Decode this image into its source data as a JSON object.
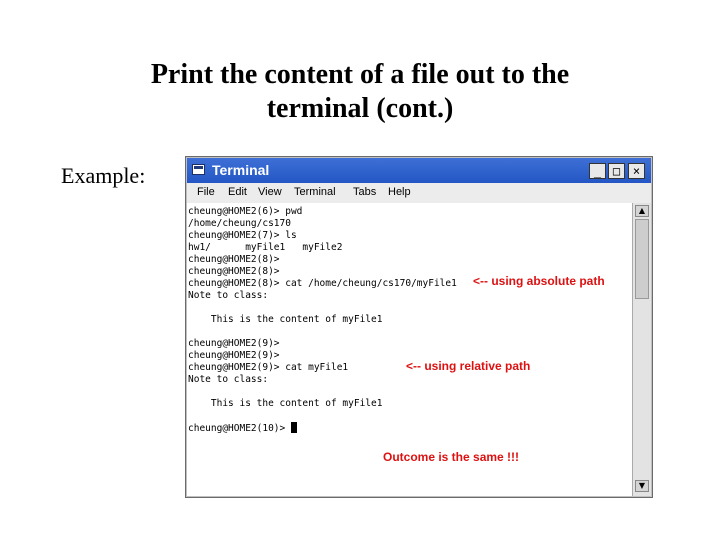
{
  "slide": {
    "title_line1": "Print the content of a file out to the",
    "title_line2": "terminal (cont.)",
    "example_label": "Example:"
  },
  "window": {
    "title": "Terminal",
    "controls": [
      "_",
      "□",
      "×"
    ]
  },
  "menu": [
    "File",
    "Edit",
    "View",
    "Terminal",
    "Tabs",
    "Help"
  ],
  "terminal_lines": [
    "cheung@HOME2(6)> pwd",
    "/home/cheung/cs170",
    "cheung@HOME2(7)> ls",
    "hw1/      myFile1   myFile2",
    "cheung@HOME2(8)>",
    "cheung@HOME2(8)>",
    "cheung@HOME2(8)> cat /home/cheung/cs170/myFile1",
    "Note to class:",
    "",
    "    This is the content of myFile1",
    "",
    "cheung@HOME2(9)>",
    "cheung@HOME2(9)>",
    "cheung@HOME2(9)> cat myFile1",
    "Note to class:",
    "",
    "    This is the content of myFile1",
    "",
    "cheung@HOME2(10)>"
  ],
  "annotations": {
    "absolute": "<-- using absolute path",
    "relative": "<-- using relative path",
    "outcome": "Outcome is the same !!!"
  },
  "scrollbar": {
    "up": "▲",
    "down": "▼"
  }
}
